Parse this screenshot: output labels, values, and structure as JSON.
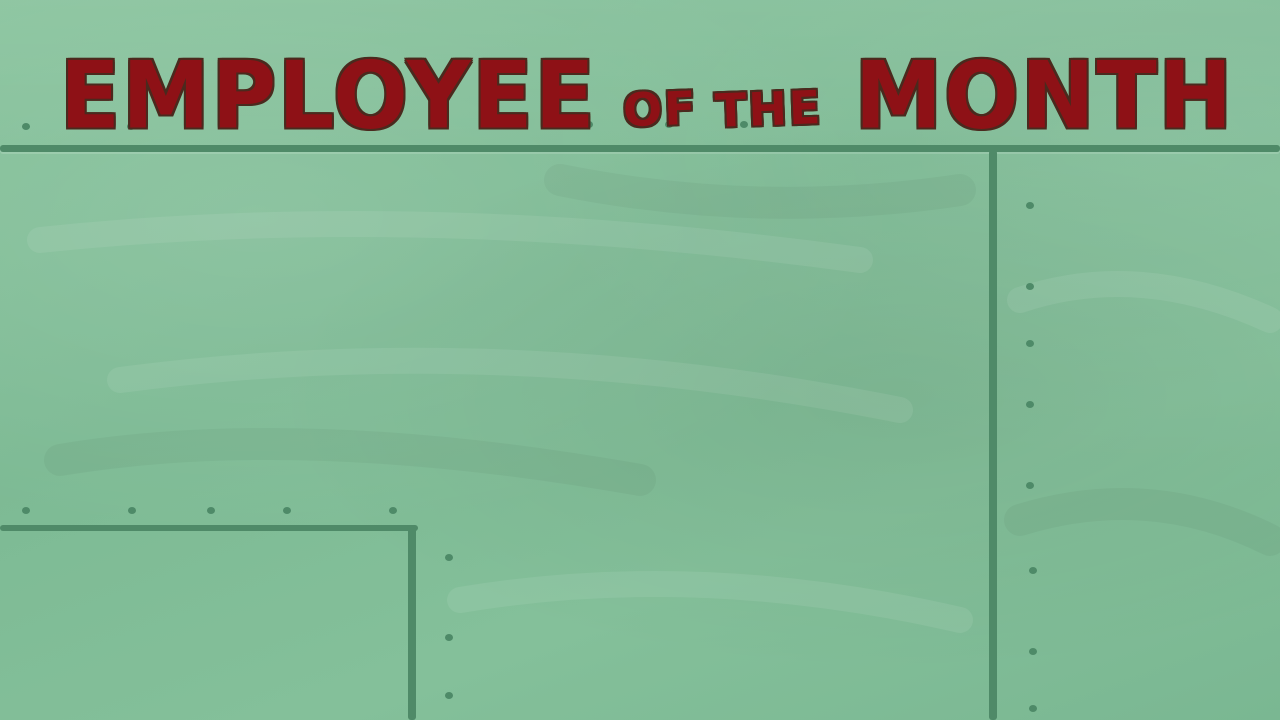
{
  "sign": {
    "title_part1": "EMPLOYEE",
    "title_part2": "OF",
    "title_part3": "THE",
    "title_part4": "MONTH"
  },
  "colors": {
    "wall": "#7fbc96",
    "seam": "#4f8a68",
    "title_fill": "#8e1116",
    "title_outline": "#4a2a1e"
  }
}
